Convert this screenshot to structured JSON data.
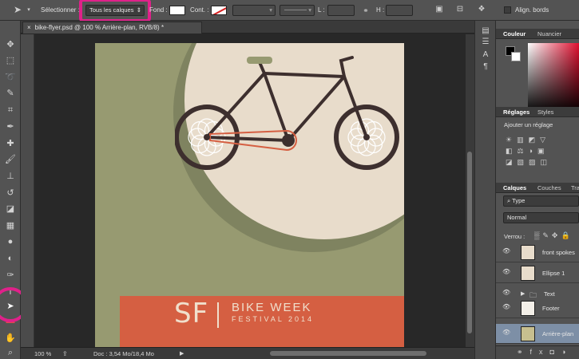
{
  "options_bar": {
    "select_label": "Sélectionner :",
    "select_value": "Tous les calques",
    "fill_label": "Fond :",
    "stroke_label": "Cont. :",
    "L_label": "L :",
    "H_label": "H :",
    "align_label": "Align. bords"
  },
  "document": {
    "tab_title": "bike-flyer.psd @ 100 % Arrière-plan, RVB/8) *",
    "close_glyph": "×"
  },
  "status_bar": {
    "zoom": "100 %",
    "doc_info": "Doc : 3,54 Mo/18,4 Mo"
  },
  "poster": {
    "sf": "SF",
    "title": "BIKE WEEK",
    "subtitle": "FESTIVAL 2014",
    "colors": {
      "background": "#979a71",
      "circle": "#e8dccb",
      "banner": "#d55f42",
      "frame": "#3d2f2e",
      "chain": "#d55f42"
    }
  },
  "panels": {
    "color_tabs": [
      "Couleur",
      "Nuancier"
    ],
    "adjust_tabs": [
      "Réglages",
      "Styles"
    ],
    "adjust_hint": "Ajouter un réglage",
    "layers_tabs": [
      "Calques",
      "Couches",
      "Tra"
    ],
    "kind_filter": "Type",
    "blend_mode": "Normal",
    "lock_label": "Verrou :",
    "layers": [
      {
        "name": "front spokes",
        "selected": false
      },
      {
        "name": "Ellipse 1",
        "selected": false
      },
      {
        "name": "Text",
        "selected": false,
        "group": true
      },
      {
        "name": "Footer",
        "selected": false
      },
      {
        "name": "Arrière-plan",
        "selected": true
      }
    ]
  },
  "highlight_color": "#e0218a",
  "icons": [
    "move-icon",
    "marquee-icon",
    "lasso-icon",
    "quick-select-icon",
    "crop-icon",
    "eyedropper-icon",
    "healing-icon",
    "brush-icon",
    "stamp-icon",
    "history-brush-icon",
    "eraser-icon",
    "gradient-icon",
    "blur-icon",
    "dodge-icon",
    "pen-icon",
    "type-icon",
    "path-select-icon",
    "shape-icon",
    "hand-icon",
    "zoom-icon",
    "eye-icon",
    "link-icon",
    "folder-icon",
    "lock-icon"
  ]
}
